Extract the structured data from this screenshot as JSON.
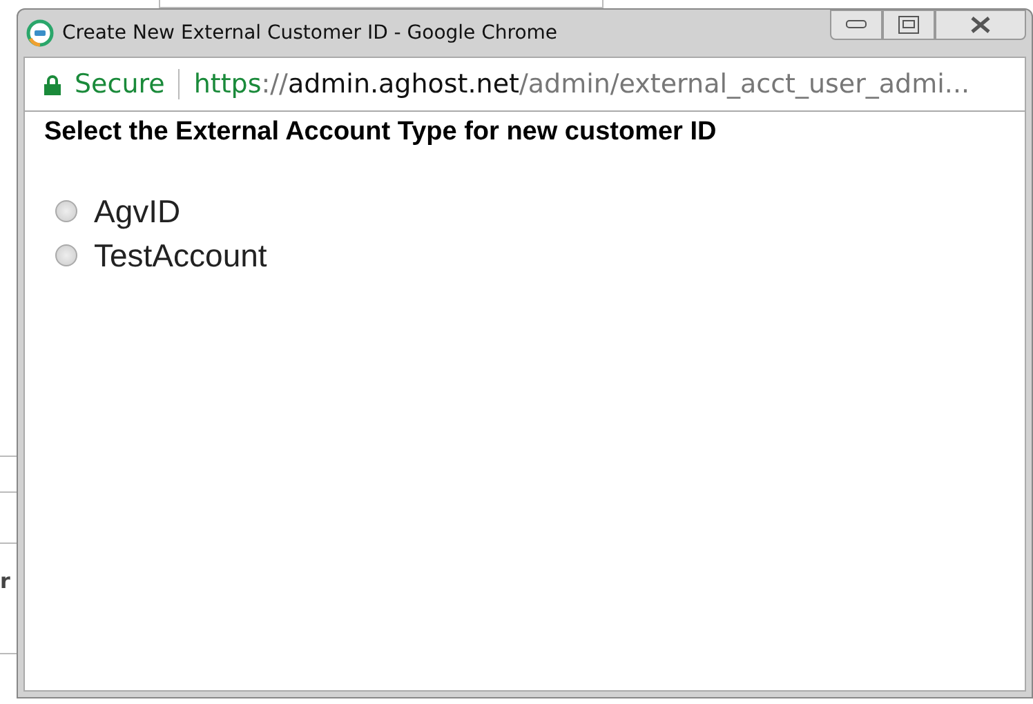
{
  "background": {
    "text": "r"
  },
  "window": {
    "title": "Create New External Customer ID - Google Chrome"
  },
  "address_bar": {
    "security": "Secure",
    "scheme": "https",
    "separator": "://",
    "host": "admin.aghost.net",
    "path": "/admin/external_acct_user_admi..."
  },
  "heading": "Select the External Account Type for new customer ID",
  "options": [
    {
      "label": "AgvID",
      "selected": false
    },
    {
      "label": "TestAccount",
      "selected": false
    }
  ]
}
